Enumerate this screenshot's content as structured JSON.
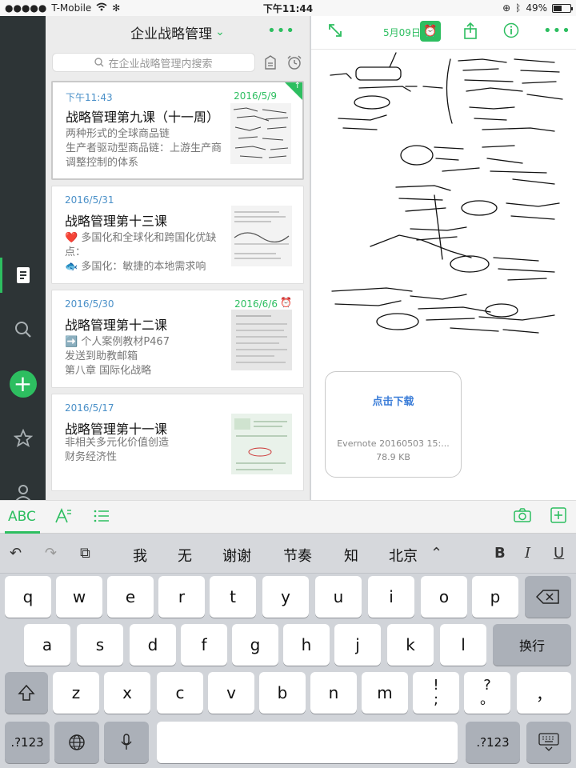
{
  "status": {
    "carrier": "T-Mobile",
    "time": "下午11:44",
    "battery": "49%"
  },
  "rail": {
    "items": [
      "notes-icon",
      "search-icon",
      "add-icon",
      "star-icon",
      "user-icon"
    ]
  },
  "list": {
    "notebook_title": "企业战略管理",
    "more": "•••",
    "search_placeholder": "在企业战略管理内搜索",
    "notes": [
      {
        "date": "下午11:43",
        "reminder_date": "2016/5/9",
        "title": "战略管理第九课（十一周）",
        "snippet": [
          "两种形式的全球商品链",
          "生产者驱动型商品链：上游生产商调整控制的体系"
        ]
      },
      {
        "date": "2016/5/31",
        "title": "战略管理第十三课",
        "snippet": [
          "❤️ 多国化和全球化和跨国化优缺点：",
          "🐟 多国化：敏捷的本地需求响"
        ]
      },
      {
        "date": "2016/5/30",
        "reminder_date": "2016/6/6",
        "title": "战略管理第十二课",
        "snippet": [
          "➡️ 个人案例教材P467",
          "发送到助教邮箱",
          "第八章 国际化战略"
        ]
      },
      {
        "date": "2016/5/17",
        "title": "战略管理第十一课",
        "snippet": [
          "非相关多元化价值创造",
          "财务经济性"
        ]
      }
    ]
  },
  "note": {
    "reminder_date": "5月09日",
    "attachment": {
      "action": "点击下载",
      "filename": "Evernote 20160503 15:...",
      "size": "78.9 KB"
    }
  },
  "format_bar": {
    "abc": "ABC"
  },
  "keyboard": {
    "candidates": [
      "我",
      "无",
      "谢谢",
      "节奏",
      "知",
      "北京"
    ],
    "format": [
      "B",
      "I",
      "U"
    ],
    "row1": [
      "q",
      "w",
      "e",
      "r",
      "t",
      "y",
      "u",
      "i",
      "o",
      "p"
    ],
    "row2": [
      "a",
      "s",
      "d",
      "f",
      "g",
      "h",
      "j",
      "k",
      "l"
    ],
    "row3": [
      "z",
      "x",
      "c",
      "v",
      "b",
      "n",
      "m"
    ],
    "return": "换行",
    "num": ".?123",
    "punct1": [
      "!",
      ";"
    ],
    "punct2": [
      "?",
      "。"
    ],
    "punct3": "，"
  },
  "colors": {
    "accent": "#2dbe60",
    "rail": "#2d3436",
    "link": "#4a90c8"
  }
}
